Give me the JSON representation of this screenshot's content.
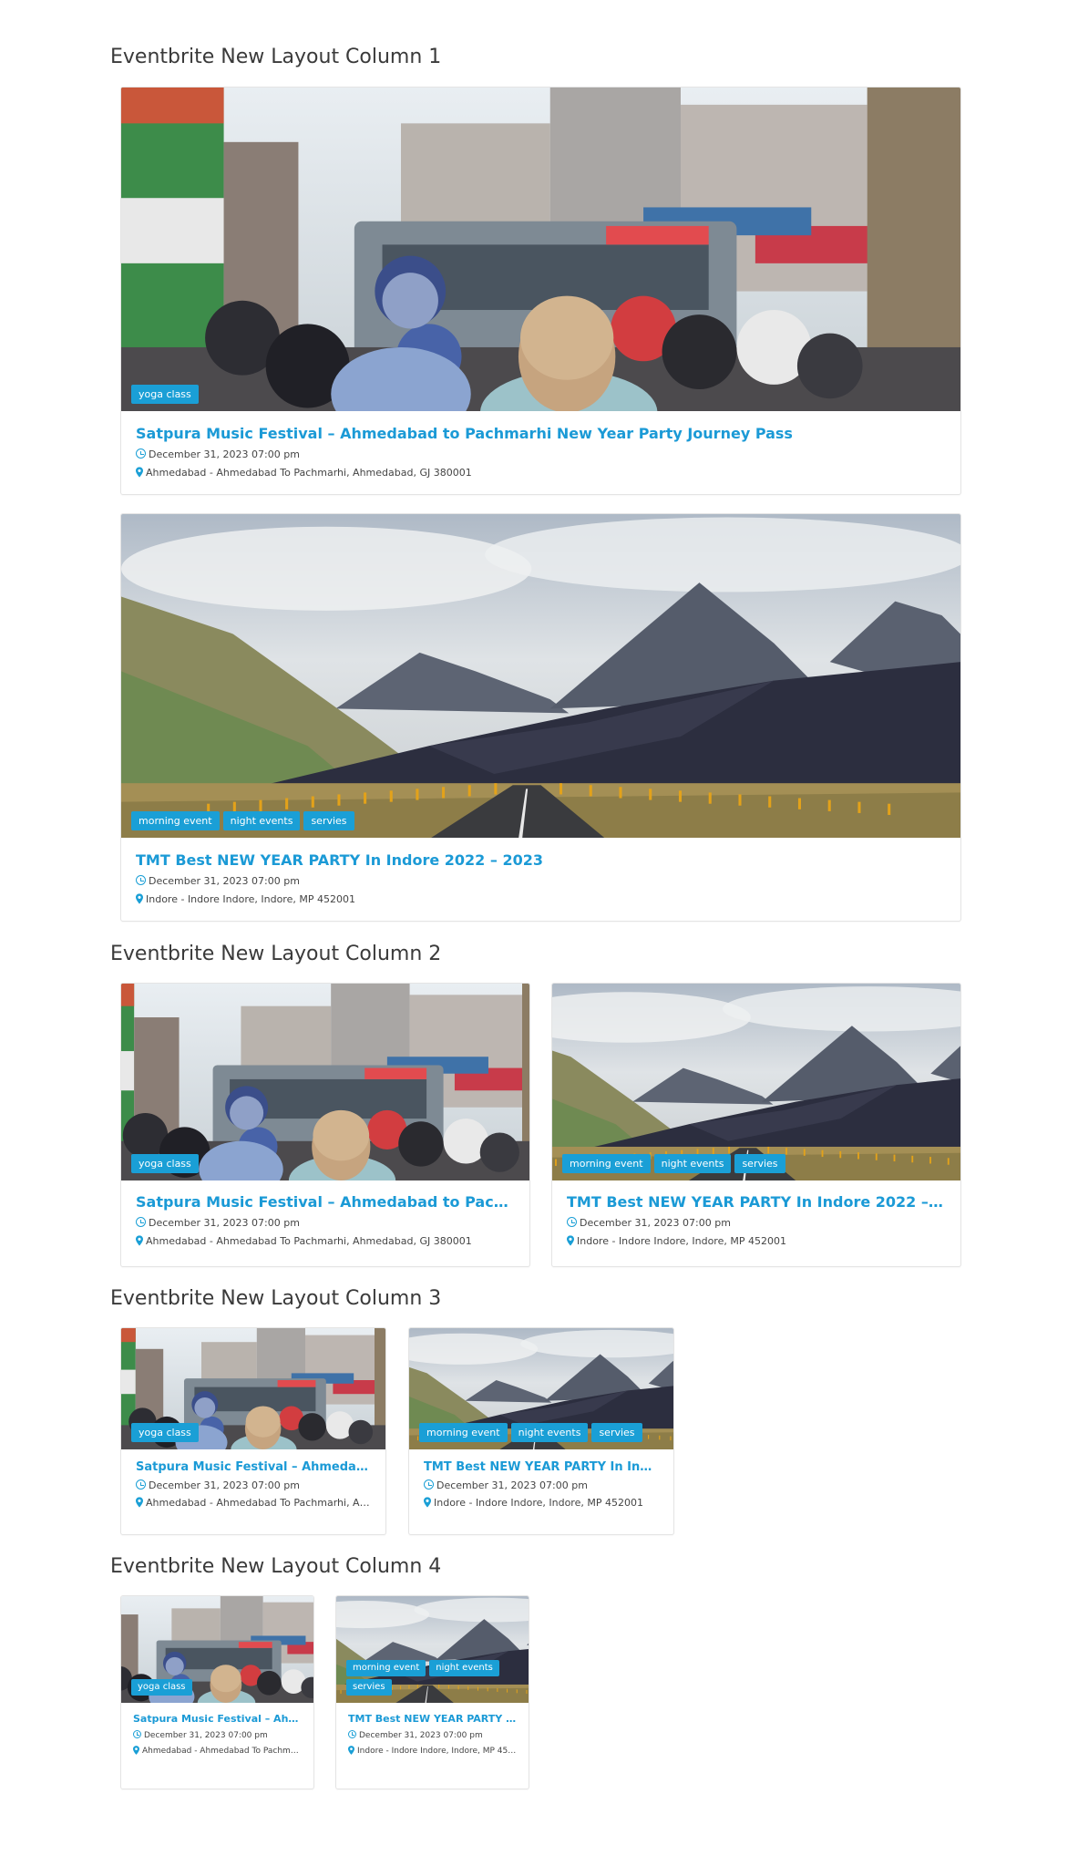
{
  "sections": [
    {
      "title": "Eventbrite New Layout Column 1"
    },
    {
      "title": "Eventbrite New Layout Column 2"
    },
    {
      "title": "Eventbrite New Layout Column 3"
    },
    {
      "title": "Eventbrite New Layout Column 4"
    }
  ],
  "events": [
    {
      "title": "Satpura Music Festival – Ahmedabad to Pachmarhi New Year Party Journey Pass",
      "date": "December 31, 2023 07:00 pm",
      "location": "Ahmedabad - Ahmedabad To Pachmarhi, Ahmedabad, GJ 380001",
      "tags": [
        "yoga class"
      ],
      "image": "street-scene"
    },
    {
      "title": "TMT Best NEW YEAR PARTY In Indore 2022 – 2023",
      "date": "December 31, 2023 07:00 pm",
      "location": "Indore - Indore Indore, Indore, MP 452001",
      "tags": [
        "morning event",
        "night events",
        "servies"
      ],
      "image": "mountain-road"
    }
  ],
  "icons": {
    "date": "clock-icon",
    "location": "map-marker-icon"
  },
  "colors": {
    "accent": "#1a9fd6",
    "title": "#1b9ad6",
    "heading": "#3a3a3a"
  }
}
